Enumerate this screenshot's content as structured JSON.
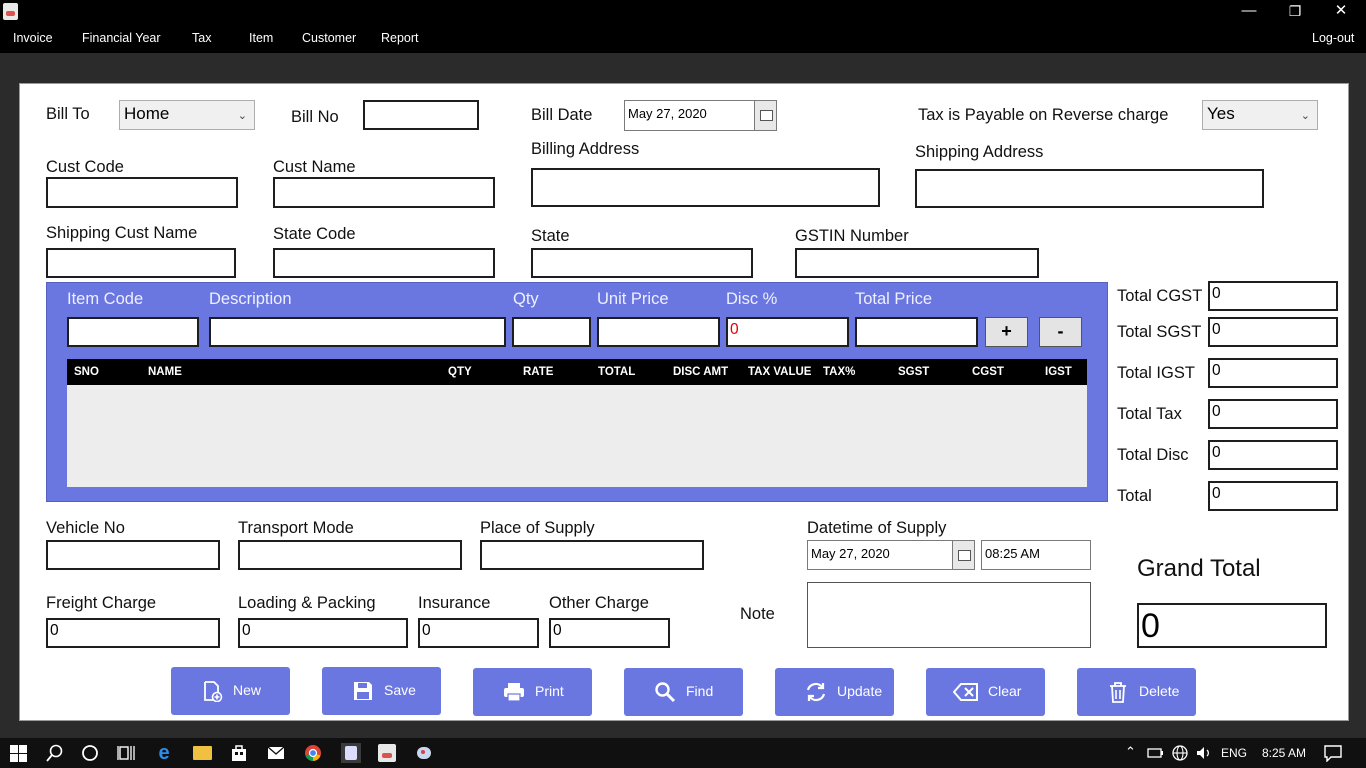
{
  "window": {
    "minimize_glyph": "—",
    "restore_glyph": "❐",
    "close_glyph": "✕"
  },
  "menu": {
    "items": [
      "Invoice",
      "Financial Year",
      "Tax",
      "Item",
      "Customer",
      "Report"
    ],
    "logout": "Log-out"
  },
  "header": {
    "bill_to_label": "Bill To",
    "bill_to_value": "Home",
    "bill_no_label": "Bill No",
    "bill_no_value": "",
    "bill_date_label": "Bill Date",
    "bill_date_value": "May 27, 2020",
    "reverse_charge_label": "Tax is Payable on Reverse charge",
    "reverse_charge_value": "Yes"
  },
  "customer": {
    "cust_code_label": "Cust Code",
    "cust_name_label": "Cust Name",
    "billing_address_label": "Billing Address",
    "shipping_address_label": "Shipping Address",
    "shipping_cust_name_label": "Shipping Cust Name",
    "state_code_label": "State Code",
    "state_label": "State",
    "gstin_label": "GSTIN Number"
  },
  "item_entry": {
    "item_code_label": "Item Code",
    "description_label": "Description",
    "qty_label": "Qty",
    "unit_price_label": "Unit Price",
    "disc_label": "Disc %",
    "disc_value": "0",
    "total_price_label": "Total Price",
    "add_label": "+",
    "remove_label": "-"
  },
  "grid": {
    "columns": [
      "SNO",
      "NAME",
      "QTY",
      "RATE",
      "TOTAL",
      "DISC AMT",
      "TAX VALUE",
      "TAX%",
      "SGST",
      "CGST",
      "IGST"
    ]
  },
  "totals": [
    {
      "label": "Total CGST",
      "value": "0"
    },
    {
      "label": "Total SGST",
      "value": "0"
    },
    {
      "label": "Total IGST",
      "value": "0"
    },
    {
      "label": "Total Tax",
      "value": "0"
    },
    {
      "label": "Total Disc",
      "value": "0"
    },
    {
      "label": "Total",
      "value": "0"
    }
  ],
  "transport": {
    "vehicle_no_label": "Vehicle No",
    "transport_mode_label": "Transport Mode",
    "place_of_supply_label": "Place of Supply",
    "datetime_supply_label": "Datetime of Supply",
    "supply_date_value": "May 27, 2020",
    "supply_time_value": "08:25 AM"
  },
  "charges": {
    "freight_label": "Freight Charge",
    "freight_value": "0",
    "loading_label": "Loading & Packing",
    "loading_value": "0",
    "insurance_label": "Insurance",
    "insurance_value": "0",
    "other_label": "Other Charge",
    "other_value": "0",
    "note_label": "Note"
  },
  "grand_total": {
    "label": "Grand Total",
    "value": "0"
  },
  "actions": {
    "new": "New",
    "save": "Save",
    "print": "Print",
    "find": "Find",
    "update": "Update",
    "clear": "Clear",
    "delete": "Delete"
  },
  "taskbar": {
    "language": "ENG",
    "clock": "8:25 AM"
  },
  "colors": {
    "accent": "#6b77e0",
    "grid_header": "#000000",
    "disc_value": "#e00000"
  }
}
